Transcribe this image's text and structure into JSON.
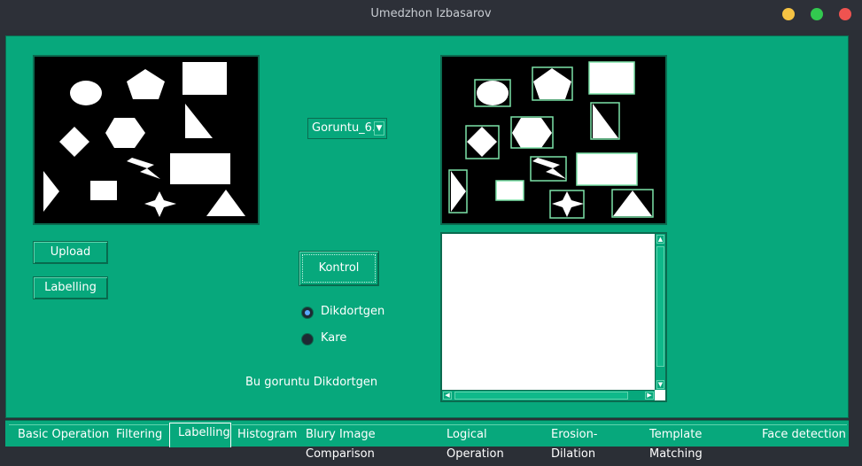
{
  "window": {
    "title": "Umedzhon Izbasarov"
  },
  "buttons": {
    "upload": "Upload",
    "labelling": "Labelling",
    "kontrol": "Kontrol"
  },
  "combo": {
    "value": "Goruntu_6."
  },
  "radios": [
    {
      "label": "Dikdortgen",
      "checked": true
    },
    {
      "label": "Kare",
      "checked": false
    }
  ],
  "status_text": "Bu goruntu Dikdortgen",
  "tabs": [
    "Basic Operation",
    "Filtering",
    "Labelling",
    "Histogram",
    "Blury Image Comparison",
    "Logical Operation",
    "Erosion-Dilation",
    "Template Matching",
    "Face detection"
  ],
  "active_tab": "Labelling",
  "colors": {
    "panel": "#07a87c",
    "titlebar": "#2d3038",
    "close": "#ef5350",
    "minimize": "#f6c343",
    "maximize": "#32c94f"
  }
}
